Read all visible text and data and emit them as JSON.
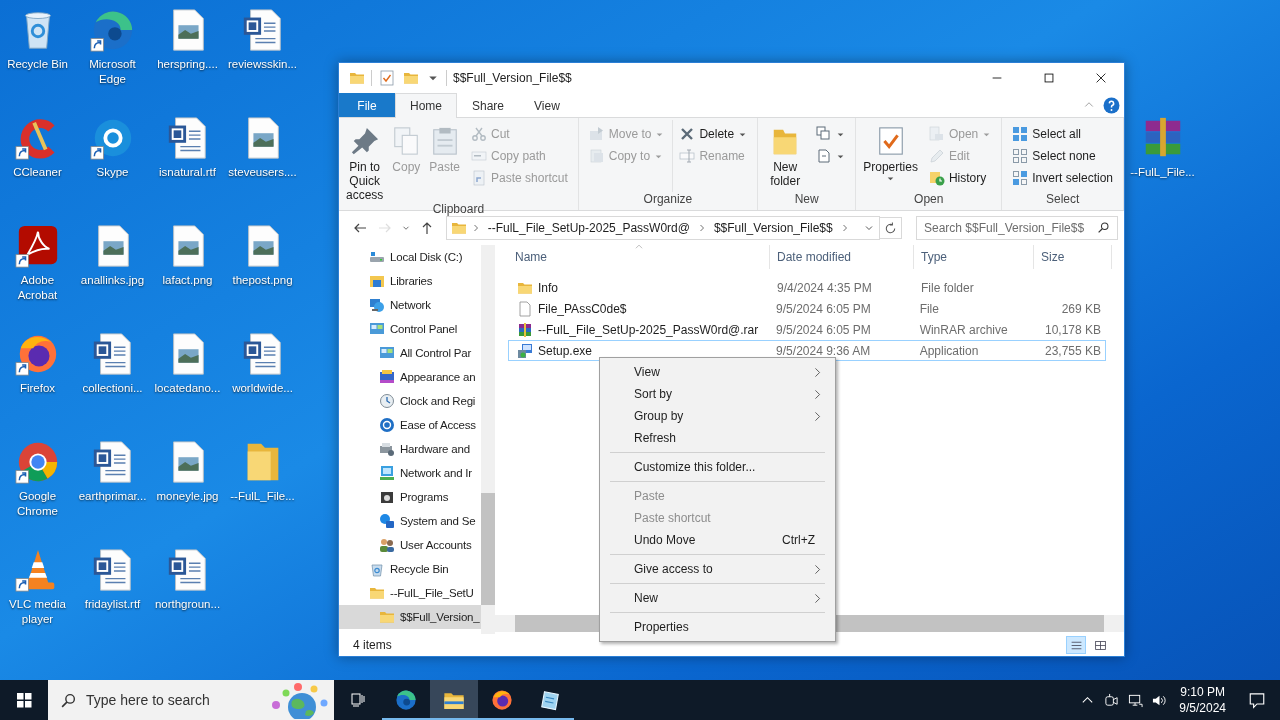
{
  "desktop": {
    "icons": [
      {
        "label": "Recycle Bin",
        "kind": "recycle",
        "shortcut": false
      },
      {
        "label": "CCleaner",
        "kind": "ccleaner",
        "shortcut": true
      },
      {
        "label": "Adobe Acrobat",
        "kind": "acrobat",
        "shortcut": true
      },
      {
        "label": "Firefox",
        "kind": "firefox",
        "shortcut": true
      },
      {
        "label": "Google Chrome",
        "kind": "chrome",
        "shortcut": true
      },
      {
        "label": "VLC media player",
        "kind": "vlc",
        "shortcut": true
      },
      {
        "label": "Microsoft Edge",
        "kind": "edge",
        "shortcut": true
      },
      {
        "label": "Skype",
        "kind": "skype",
        "shortcut": true
      },
      {
        "label": "anallinks.jpg",
        "kind": "image",
        "shortcut": false
      },
      {
        "label": "collectioni...",
        "kind": "word",
        "shortcut": false
      },
      {
        "label": "earthprimar...",
        "kind": "word",
        "shortcut": false
      },
      {
        "label": "fridaylist.rtf",
        "kind": "word",
        "shortcut": false
      },
      {
        "label": "herspring....",
        "kind": "image",
        "shortcut": false
      },
      {
        "label": "isnatural.rtf",
        "kind": "word",
        "shortcut": false
      },
      {
        "label": "lafact.png",
        "kind": "image",
        "shortcut": false
      },
      {
        "label": "locatedano...",
        "kind": "image",
        "shortcut": false
      },
      {
        "label": "moneyle.jpg",
        "kind": "image",
        "shortcut": false
      },
      {
        "label": "northgroun...",
        "kind": "word",
        "shortcut": false
      },
      {
        "label": "reviewsskin...",
        "kind": "word",
        "shortcut": false
      },
      {
        "label": "steveusers....",
        "kind": "image",
        "shortcut": false
      },
      {
        "label": "thepost.png",
        "kind": "image",
        "shortcut": false
      },
      {
        "label": "worldwide...",
        "kind": "word",
        "shortcut": false
      },
      {
        "label": "--FulL_File...",
        "kind": "folder",
        "shortcut": false
      }
    ],
    "side_icon": {
      "label": "--FulL_File...",
      "kind": "winrar",
      "shortcut": false
    }
  },
  "window": {
    "title": "$$Full_Version_File$$"
  },
  "ribbon": {
    "tabs": [
      {
        "label": "File",
        "kind": "file",
        "selected": false
      },
      {
        "label": "Home",
        "kind": "tab",
        "selected": true
      },
      {
        "label": "Share",
        "kind": "tab",
        "selected": false
      },
      {
        "label": "View",
        "kind": "tab",
        "selected": false
      }
    ],
    "groups": [
      {
        "label": "Clipboard",
        "large": [
          {
            "label": "Pin to Quick access",
            "kind": "pin",
            "disabled": false,
            "dropdown": false
          },
          {
            "label": "Copy",
            "kind": "copy",
            "disabled": true,
            "dropdown": false
          },
          {
            "label": "Paste",
            "kind": "paste",
            "disabled": true,
            "dropdown": false
          }
        ],
        "small": [
          [
            {
              "label": "Cut",
              "kind": "cut",
              "disabled": true,
              "dropdown": false
            },
            {
              "label": "Copy path",
              "kind": "copypath",
              "disabled": true,
              "dropdown": false
            },
            {
              "label": "Paste shortcut",
              "kind": "pasteshortcut",
              "disabled": true,
              "dropdown": false
            }
          ]
        ]
      },
      {
        "label": "Organize",
        "small": [
          [
            {
              "label": "Move to",
              "kind": "moveto",
              "disabled": true,
              "dropdown": true
            },
            {
              "label": "Copy to",
              "kind": "copyto",
              "disabled": true,
              "dropdown": true
            }
          ],
          [
            {
              "label": "Delete",
              "kind": "delete",
              "disabled": false,
              "dropdown": true
            },
            {
              "label": "Rename",
              "kind": "rename",
              "disabled": true,
              "dropdown": false
            }
          ]
        ]
      },
      {
        "label": "New",
        "large": [
          {
            "label": "New folder",
            "kind": "newfolder",
            "disabled": false,
            "dropdown": false
          }
        ],
        "small": [
          [
            {
              "kind": "newitem",
              "disabled": false,
              "dropdown": true
            },
            {
              "kind": "easyaccess",
              "disabled": false,
              "dropdown": true
            }
          ]
        ]
      },
      {
        "label": "Open",
        "large": [
          {
            "label": "Properties",
            "kind": "properties",
            "disabled": false,
            "dropdown": true
          }
        ],
        "small": [
          [
            {
              "label": "Open",
              "kind": "open",
              "disabled": true,
              "dropdown": true
            },
            {
              "label": "Edit",
              "kind": "edit",
              "disabled": true,
              "dropdown": false
            },
            {
              "label": "History",
              "kind": "history",
              "disabled": false,
              "dropdown": false
            }
          ]
        ]
      },
      {
        "label": "Select",
        "small": [
          [
            {
              "label": "Select all",
              "kind": "selectall",
              "disabled": false,
              "dropdown": false
            },
            {
              "label": "Select none",
              "kind": "selectnone",
              "disabled": false,
              "dropdown": false
            },
            {
              "label": "Invert selection",
              "kind": "invert",
              "disabled": false,
              "dropdown": false
            }
          ]
        ]
      }
    ]
  },
  "nav_buttons": [
    {
      "kind": "back",
      "disabled": false
    },
    {
      "kind": "forward",
      "disabled": true
    },
    {
      "kind": "recent",
      "disabled": false
    },
    {
      "kind": "up",
      "disabled": false
    }
  ],
  "address": {
    "crumbs": [
      "--FulL_File_SetUp-2025_PassW0rd@",
      "$$Full_Version_File$$"
    ],
    "search_placeholder": "Search $$Full_Version_File$$"
  },
  "nav": {
    "items": [
      {
        "label": "Local Disk (C:)",
        "kind": "disk",
        "selected": false
      },
      {
        "label": "Libraries",
        "kind": "libraries",
        "selected": false
      },
      {
        "label": "Network",
        "kind": "network",
        "selected": false
      },
      {
        "label": "Control Panel",
        "kind": "control",
        "selected": false,
        "children": [
          {
            "label": "All Control Par",
            "kind": "control",
            "selected": false
          },
          {
            "label": "Appearance an",
            "kind": "appearance",
            "selected": false
          },
          {
            "label": "Clock and Regi",
            "kind": "clock",
            "selected": false
          },
          {
            "label": "Ease of Access",
            "kind": "ease",
            "selected": false
          },
          {
            "label": "Hardware and",
            "kind": "hardware",
            "selected": false
          },
          {
            "label": "Network and Ir",
            "kind": "netcenter",
            "selected": false
          },
          {
            "label": "Programs",
            "kind": "programs",
            "selected": false
          },
          {
            "label": "System and Se",
            "kind": "system",
            "selected": false
          },
          {
            "label": "User Accounts",
            "kind": "users",
            "selected": false
          }
        ]
      },
      {
        "label": "Recycle Bin",
        "kind": "recycle",
        "selected": false
      },
      {
        "label": "--FulL_File_SetU",
        "kind": "folder",
        "selected": false,
        "children": [
          {
            "label": "$$Full_Version_",
            "kind": "folder",
            "selected": true
          }
        ]
      }
    ]
  },
  "files": {
    "columns": [
      {
        "label": "Name",
        "sorted": true
      },
      {
        "label": "Date modified",
        "sorted": false
      },
      {
        "label": "Type",
        "sorted": false
      },
      {
        "label": "Size",
        "sorted": false
      }
    ],
    "rows": [
      {
        "name": "Info",
        "date": "9/4/2024 4:35 PM",
        "type": "File folder",
        "kind": "folder",
        "focused": false
      },
      {
        "name": "File_PAssC0de$",
        "date": "9/5/2024 6:05 PM",
        "type": "File",
        "size": "269 KB",
        "kind": "file",
        "focused": false
      },
      {
        "name": "--FulL_File_SetUp-2025_PassW0rd@.rar",
        "date": "9/5/2024 6:05 PM",
        "type": "WinRAR archive",
        "size": "10,178 KB",
        "kind": "winrar",
        "focused": false
      },
      {
        "name": "Setup.exe",
        "date": "9/5/2024 9:36 AM",
        "type": "Application",
        "size": "23,755 KB",
        "kind": "setup",
        "focused": true
      }
    ]
  },
  "status_bar": {
    "text": "4 items",
    "views": [
      {
        "kind": "details",
        "selected": true
      },
      {
        "kind": "tiles",
        "selected": false
      }
    ]
  },
  "context_menu": {
    "items": [
      {
        "kind": "item",
        "label": "View",
        "submenu": true,
        "disabled": false
      },
      {
        "kind": "item",
        "label": "Sort by",
        "submenu": true,
        "disabled": false
      },
      {
        "kind": "item",
        "label": "Group by",
        "submenu": true,
        "disabled": false
      },
      {
        "kind": "item",
        "label": "Refresh",
        "submenu": false,
        "disabled": false
      },
      {
        "kind": "separator"
      },
      {
        "kind": "item",
        "label": "Customize this folder...",
        "submenu": false,
        "disabled": false
      },
      {
        "kind": "separator"
      },
      {
        "kind": "item",
        "label": "Paste",
        "submenu": false,
        "disabled": true
      },
      {
        "kind": "item",
        "label": "Paste shortcut",
        "submenu": false,
        "disabled": true
      },
      {
        "kind": "item",
        "label": "Undo Move",
        "shortcut": "Ctrl+Z",
        "submenu": false,
        "disabled": false
      },
      {
        "kind": "separator"
      },
      {
        "kind": "item",
        "label": "Give access to",
        "submenu": true,
        "disabled": false
      },
      {
        "kind": "separator"
      },
      {
        "kind": "item",
        "label": "New",
        "submenu": true,
        "disabled": false
      },
      {
        "kind": "separator"
      },
      {
        "kind": "item",
        "label": "Properties",
        "submenu": false,
        "disabled": false
      }
    ]
  },
  "taskbar": {
    "search_placeholder": "Type here to search",
    "apps": [
      {
        "kind": "taskview",
        "running": false,
        "active": false
      },
      {
        "kind": "edge",
        "running": true,
        "active": false
      },
      {
        "kind": "explorer",
        "running": true,
        "active": true
      },
      {
        "kind": "firefox",
        "running": true,
        "active": false
      },
      {
        "kind": "notepad",
        "running": true,
        "active": false
      }
    ],
    "tray": [
      {
        "kind": "chevron"
      },
      {
        "kind": "meet"
      },
      {
        "kind": "network"
      },
      {
        "kind": "volume"
      }
    ],
    "time": "9:10 PM",
    "date": "9/5/2024"
  }
}
